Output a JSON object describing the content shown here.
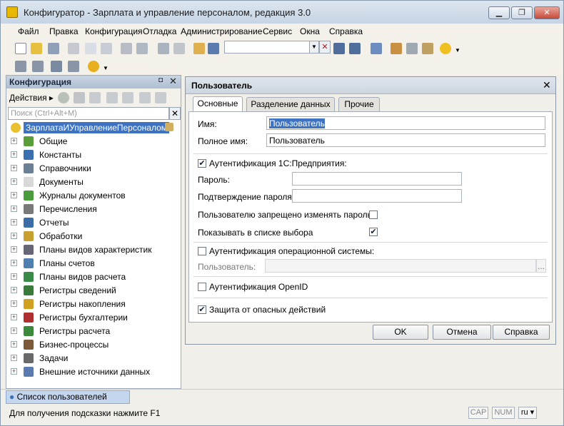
{
  "window": {
    "title": "Конфигуратор - Зарплата и управление персоналом, редакция 3.0"
  },
  "menu": [
    "Файл",
    "Правка",
    "Конфигурация",
    "Отладка",
    "Администрирование",
    "Сервис",
    "Окна",
    "Справка"
  ],
  "left_panel": {
    "title": "Конфигурация",
    "actions_label": "Действия",
    "search_placeholder": "Поиск (Ctrl+Alt+M)",
    "root": "ЗарплатаИУправлениеПерсоналом",
    "items": [
      {
        "label": "Общие",
        "icon": "common-icon",
        "color": "#5a9e3a"
      },
      {
        "label": "Константы",
        "icon": "constants-icon",
        "color": "#3a6fb0"
      },
      {
        "label": "Справочники",
        "icon": "catalogs-icon",
        "color": "#6b7f95"
      },
      {
        "label": "Документы",
        "icon": "documents-icon",
        "color": "#d8d8d8"
      },
      {
        "label": "Журналы документов",
        "icon": "journals-icon",
        "color": "#4a9c3c"
      },
      {
        "label": "Перечисления",
        "icon": "enums-icon",
        "color": "#7a7a7a"
      },
      {
        "label": "Отчеты",
        "icon": "reports-icon",
        "color": "#3b6ea8"
      },
      {
        "label": "Обработки",
        "icon": "dataprocessors-icon",
        "color": "#c8a030"
      },
      {
        "label": "Планы видов характеристик",
        "icon": "chart-of-characteristic-types-icon",
        "color": "#667"
      },
      {
        "label": "Планы счетов",
        "icon": "chart-of-accounts-icon",
        "color": "#5080b0"
      },
      {
        "label": "Планы видов расчета",
        "icon": "chart-of-calculation-types-icon",
        "color": "#3a8a4a"
      },
      {
        "label": "Регистры сведений",
        "icon": "information-registers-icon",
        "color": "#3a7a3a"
      },
      {
        "label": "Регистры накопления",
        "icon": "accumulation-registers-icon",
        "color": "#d0a020"
      },
      {
        "label": "Регистры бухгалтерии",
        "icon": "accounting-registers-icon",
        "color": "#b03030"
      },
      {
        "label": "Регистры расчета",
        "icon": "calculation-registers-icon",
        "color": "#3a8a3a"
      },
      {
        "label": "Бизнес-процессы",
        "icon": "business-processes-icon",
        "color": "#7a5a3a"
      },
      {
        "label": "Задачи",
        "icon": "tasks-icon",
        "color": "#6a6a6a"
      },
      {
        "label": "Внешние источники данных",
        "icon": "external-data-sources-icon",
        "color": "#5a7ab0"
      }
    ]
  },
  "dialog": {
    "title": "Пользователь",
    "tabs": [
      "Основные",
      "Разделение данных",
      "Прочие"
    ],
    "name_label": "Имя:",
    "name_value": "Пользователь",
    "fullname_label": "Полное имя:",
    "fullname_value": "Пользователь",
    "auth_1c_label": "Аутентификация 1С:Предприятия:",
    "password_label": "Пароль:",
    "password_confirm_label": "Подтверждение пароля:",
    "cannot_change_password_label": "Пользователю запрещено изменять пароль",
    "show_in_list_label": "Показывать в списке выбора",
    "os_auth_label": "Аутентификация операционной системы:",
    "os_user_label": "Пользователь:",
    "os_user_button": "...",
    "openid_label": "Аутентификация OpenID",
    "danger_protection_label": "Защита от опасных действий",
    "ok": "OK",
    "cancel": "Отмена",
    "help": "Справка"
  },
  "taskbar": {
    "item": "Список пользователей"
  },
  "status": {
    "hint": "Для получения подсказки нажмите F1",
    "cap": "CAP",
    "num": "NUM",
    "lang": "ru"
  }
}
